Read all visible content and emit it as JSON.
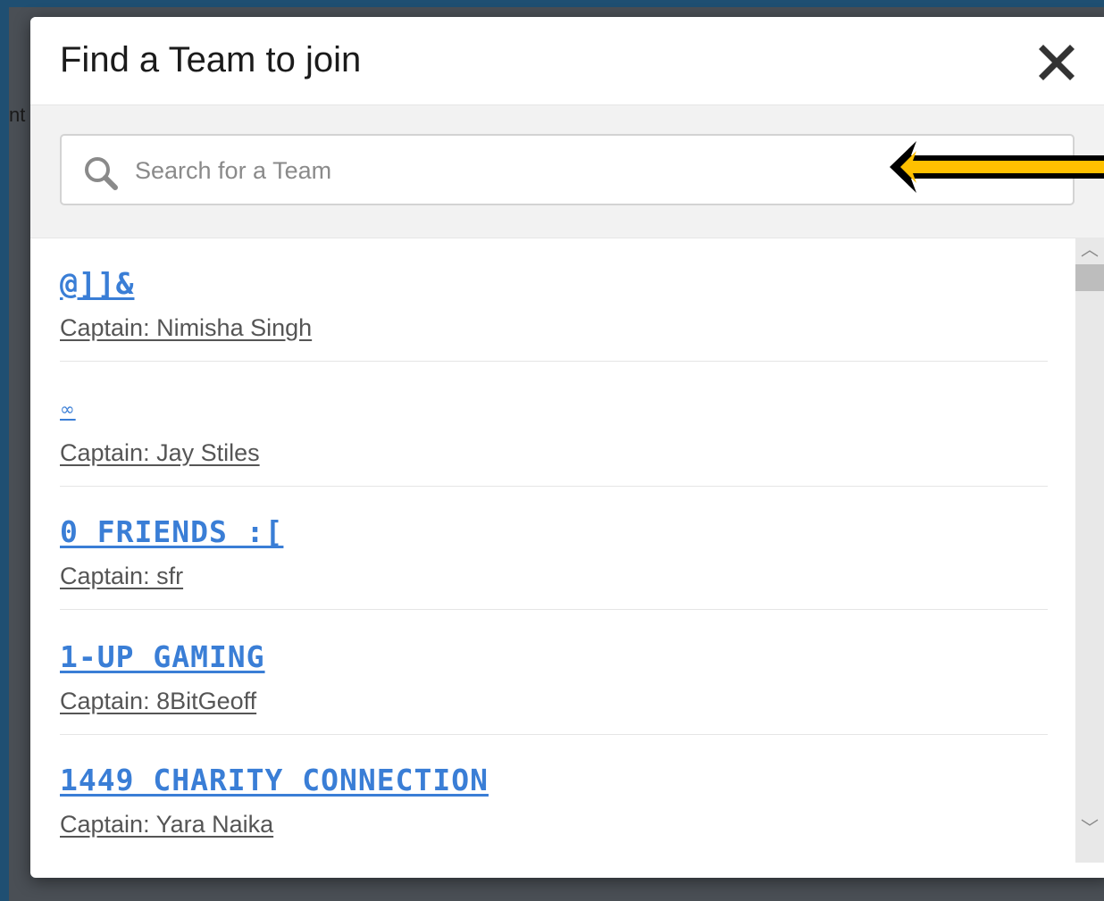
{
  "background": {
    "fragment_text": "nt"
  },
  "modal": {
    "title": "Find a Team to join",
    "close_icon": "close-x-icon"
  },
  "search": {
    "placeholder": "Search for a Team",
    "value": "",
    "icon": "search-icon"
  },
  "annotation": {
    "arrow_color": "#ffc000",
    "arrow_outline": "#000000"
  },
  "colors": {
    "link": "#3a7ed6",
    "captain_text": "#555555",
    "search_band": "#f2f2f2"
  },
  "teams": [
    {
      "name": "@]]&",
      "captain": "Captain: Nimisha Singh"
    },
    {
      "name": "∞",
      "captain": "Captain: Jay Stiles"
    },
    {
      "name": "0 FRIENDS :[",
      "captain": "Captain: sfr"
    },
    {
      "name": "1-UP GAMING",
      "captain": "Captain: 8BitGeoff"
    },
    {
      "name": "1449 CHARITY CONNECTION",
      "captain": "Captain: Yara Naika"
    }
  ],
  "scrollbar": {
    "up_glyph": "︿",
    "down_glyph": "﹀"
  }
}
